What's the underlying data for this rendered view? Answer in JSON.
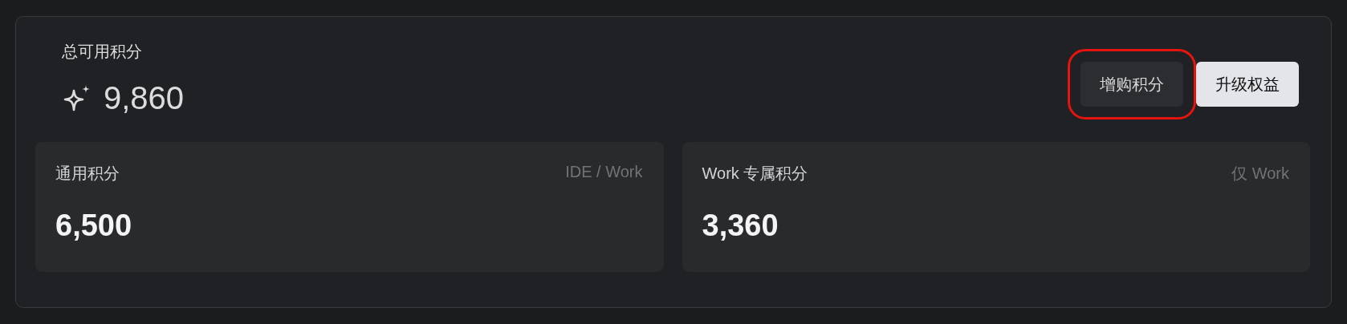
{
  "summary": {
    "title": "总可用积分",
    "total": "9,860"
  },
  "buttons": [
    {
      "label": "增购积分",
      "kind": "secondary",
      "highlighted": true
    },
    {
      "label": "升级权益",
      "kind": "primary",
      "highlighted": false
    }
  ],
  "balances": [
    {
      "label": "通用积分",
      "scope": "IDE / Work",
      "value": "6,500"
    },
    {
      "label": "Work 专属积分",
      "scope": "仅 Work",
      "value": "3,360"
    }
  ]
}
